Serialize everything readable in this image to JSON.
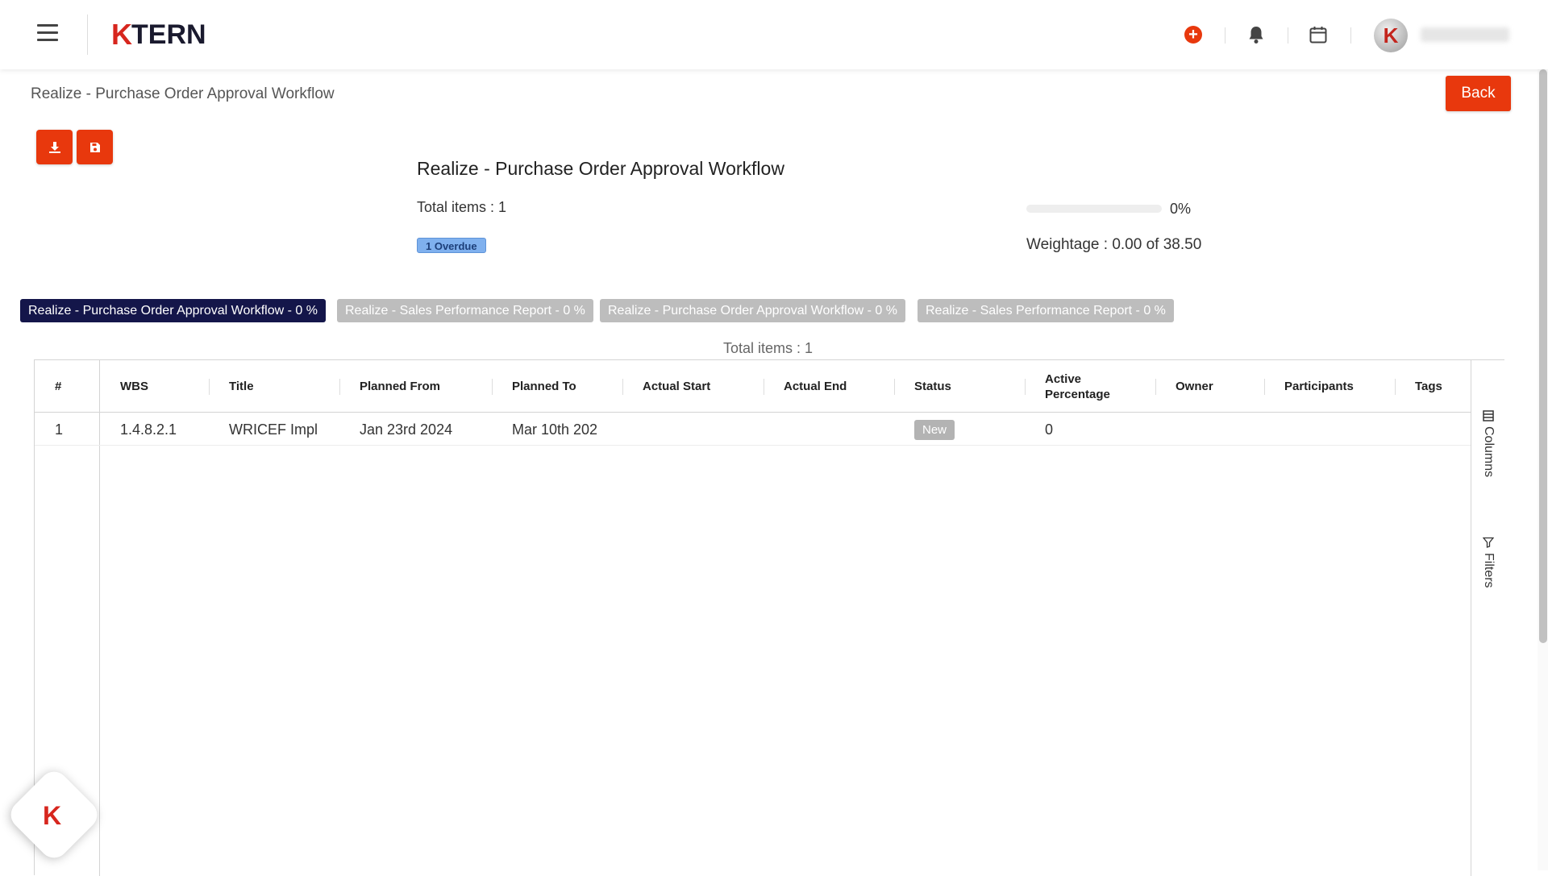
{
  "header": {
    "logo_k": "K",
    "logo_rest": "TERN",
    "avatar_letter": "K"
  },
  "breadcrumb": "Realize - Purchase Order Approval Workflow",
  "back_label": "Back",
  "summary": {
    "title": "Realize - Purchase Order Approval Workflow",
    "total_items": "Total items : 1",
    "overdue": "1 Overdue",
    "progress_label": "0%",
    "progress_fraction": 0,
    "weightage": "Weightage : 0.00 of 38.50"
  },
  "tabs": [
    {
      "label": "Realize - Purchase Order Approval Workflow - 0 %",
      "active": true
    },
    {
      "label": "Realize - Sales Performance Report - 0 %",
      "active": false
    },
    {
      "label": "Realize - Purchase Order Approval Workflow - 0 %",
      "active": false
    },
    {
      "label": "Realize - Sales Performance Report - 0 %",
      "active": false
    }
  ],
  "grid": {
    "total_items": "Total items : 1",
    "columns": [
      "#",
      "WBS",
      "Title",
      "Planned From",
      "Planned To",
      "Actual Start",
      "Actual End",
      "Status",
      "Active Percentage",
      "Owner",
      "Participants",
      "Tags"
    ],
    "rows": [
      {
        "num": "1",
        "wbs": "1.4.8.2.1",
        "title": "WRICEF Impl",
        "planned_from": "Jan 23rd 2024",
        "planned_to": "Mar 10th 202",
        "actual_start": "",
        "actual_end": "",
        "status": "New",
        "active_percentage": "0",
        "owner": "",
        "participants": "",
        "tags": ""
      }
    ],
    "side": {
      "columns_label": "Columns",
      "filters_label": "Filters"
    }
  },
  "colors": {
    "accent": "#e8380d",
    "active_tab": "#14164a",
    "inactive_tab": "#bdbdbd",
    "overdue_bg": "#7fb0ee"
  },
  "icons": [
    "menu-icon",
    "plus-circle-icon",
    "bell-icon",
    "calendar-icon",
    "download-icon",
    "save-icon",
    "columns-icon",
    "filter-icon"
  ]
}
